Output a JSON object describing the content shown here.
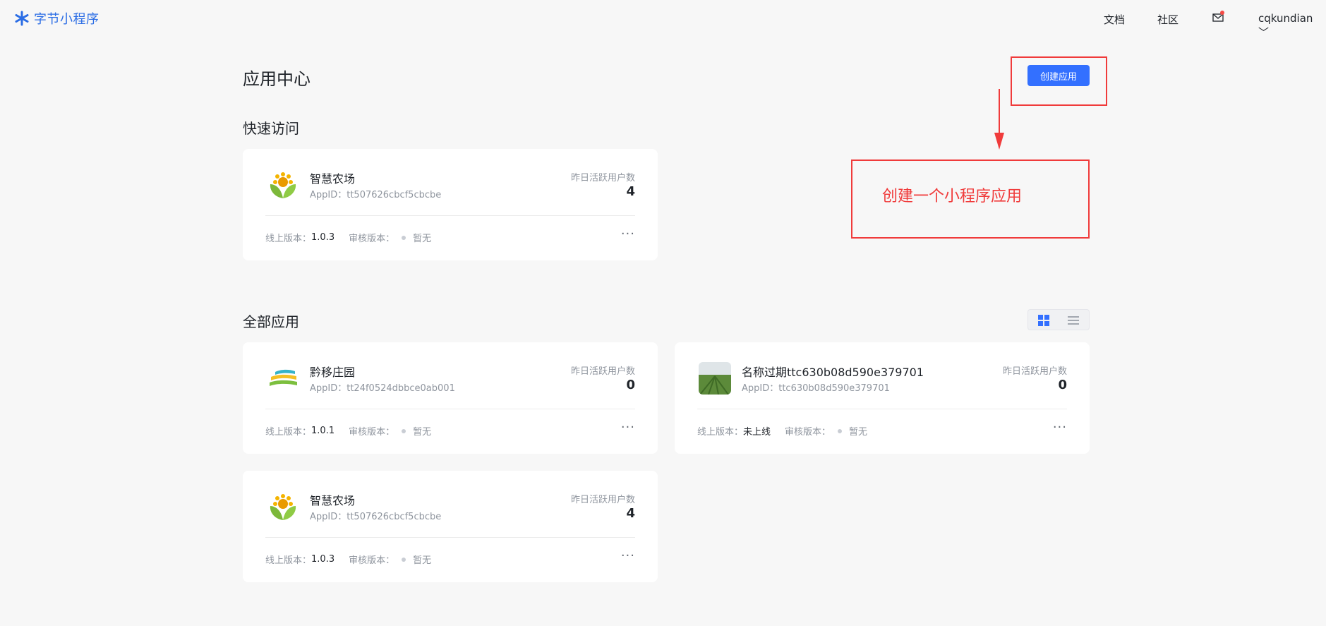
{
  "nav": {
    "logo_text": "字节小程序",
    "docs": "文档",
    "community": "社区",
    "user": "cqkundian ﹀",
    "accent": "#3370ff"
  },
  "page": {
    "title": "应用中心",
    "create_button": "创建应用",
    "quick_access_title": "快速访问",
    "all_apps_title": "全部应用"
  },
  "annotation": {
    "text": "创建一个小程序应用",
    "color": "#f03b3b"
  },
  "labels": {
    "stat": "昨日活跃用户数",
    "online_version": "线上版本：",
    "review_version": "审核版本：",
    "more": "···"
  },
  "quick_access": [
    {
      "name": "智慧农场",
      "app_id": "AppID：tt507626cbcf5cbcbe",
      "active_users": "4",
      "online_version": "1.0.3",
      "review_version": "暂无",
      "icon": "sunflower-icon"
    }
  ],
  "all_apps": [
    {
      "name": "黔移庄园",
      "app_id": "AppID：tt24f0524dbbce0ab001",
      "active_users": "0",
      "online_version": "1.0.1",
      "review_version": "暂无",
      "icon": "layered-logo-icon"
    },
    {
      "name": "名称过期ttc630b08d590e379701",
      "app_id": "AppID：ttc630b08d590e379701",
      "active_users": "0",
      "online_version": "未上线",
      "review_version": "暂无",
      "icon": "field-photo-icon"
    },
    {
      "name": "智慧农场",
      "app_id": "AppID：tt507626cbcf5cbcbe",
      "active_users": "4",
      "online_version": "1.0.3",
      "review_version": "暂无",
      "icon": "sunflower-icon"
    }
  ]
}
